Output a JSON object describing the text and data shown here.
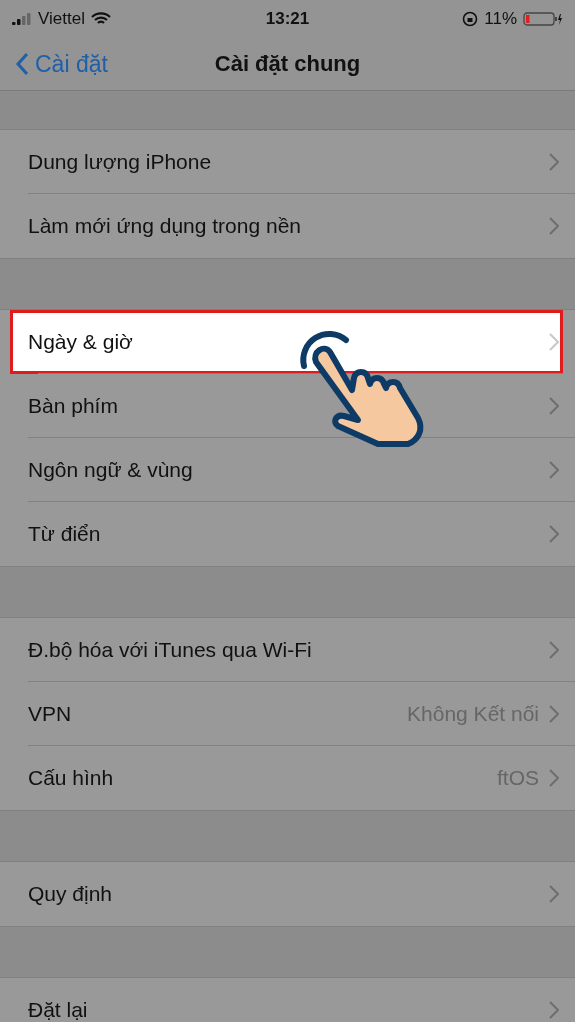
{
  "status_bar": {
    "carrier": "Viettel",
    "time": "13:21",
    "battery": "11%"
  },
  "nav": {
    "back": "Cài đặt",
    "title": "Cài đặt chung"
  },
  "sections": [
    {
      "rows": [
        {
          "label": "Dung lượng iPhone",
          "highlighted": false
        },
        {
          "label": "Làm mới ứng dụng trong nền",
          "highlighted": false
        }
      ]
    },
    {
      "rows": [
        {
          "label": "Ngày & giờ",
          "highlighted": true
        },
        {
          "label": "Bàn phím",
          "highlighted": false
        },
        {
          "label": "Ngôn ngữ & vùng",
          "highlighted": false
        },
        {
          "label": "Từ điển",
          "highlighted": false
        }
      ]
    },
    {
      "rows": [
        {
          "label": "Đ.bộ hóa với iTunes qua Wi-Fi",
          "highlighted": false
        },
        {
          "label": "VPN",
          "value": "Không Kết nối",
          "highlighted": false
        },
        {
          "label": "Cấu hình",
          "value": "ftOS",
          "highlighted": false
        }
      ]
    },
    {
      "rows": [
        {
          "label": "Quy định",
          "highlighted": false
        }
      ]
    },
    {
      "rows": [
        {
          "label": "Đặt lại",
          "highlighted": false
        }
      ]
    }
  ]
}
